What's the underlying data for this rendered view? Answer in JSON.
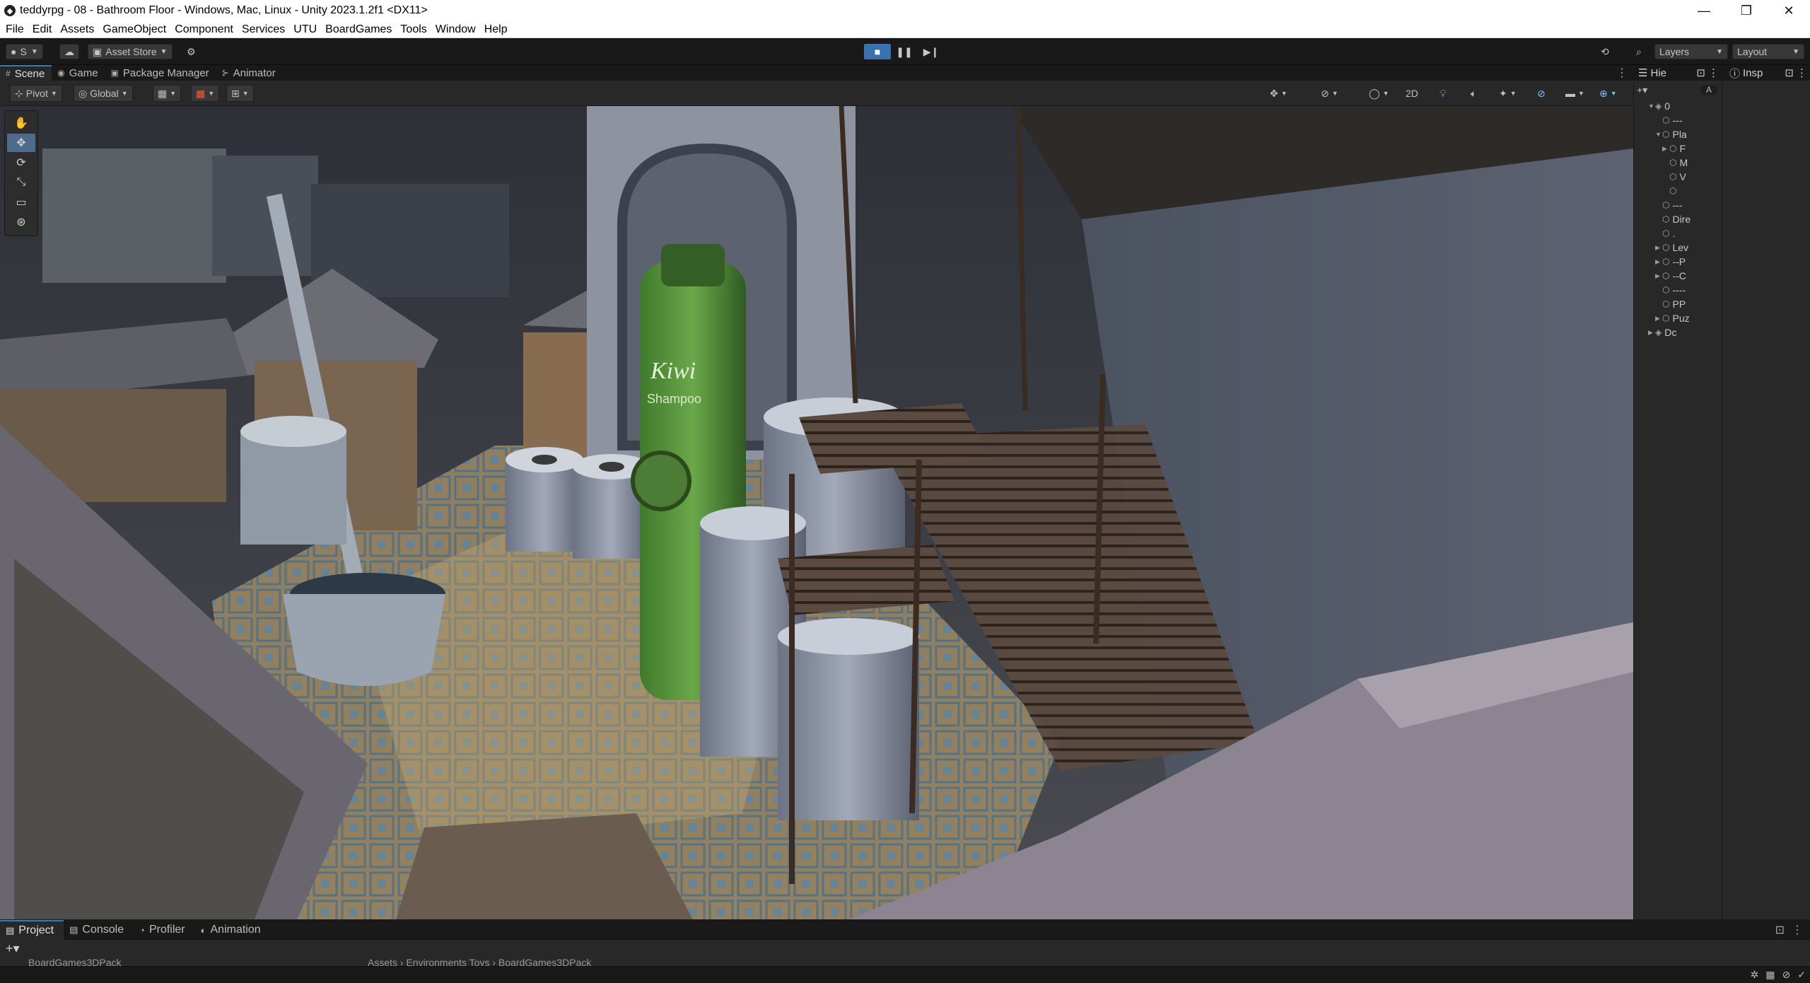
{
  "window": {
    "title": "teddyrpg - 08 - Bathroom Floor - Windows, Mac, Linux - Unity 2023.1.2f1 <DX11>",
    "controls": [
      "—",
      "❐",
      "✕"
    ]
  },
  "menu": [
    "File",
    "Edit",
    "Assets",
    "GameObject",
    "Component",
    "Services",
    "UTU",
    "BoardGames",
    "Tools",
    "Window",
    "Help"
  ],
  "toolbar": {
    "account_label": "S",
    "asset_store_label": "Asset Store",
    "layers_label": "Layers",
    "layout_label": "Layout",
    "play_active": "stop"
  },
  "tabs": [
    {
      "label": "Scene",
      "icon": "#"
    },
    {
      "label": "Game",
      "icon": "◉"
    },
    {
      "label": "Package Manager",
      "icon": "▣"
    },
    {
      "label": "Animator",
      "icon": "⊱"
    }
  ],
  "scene_tools": {
    "pivot_label": "Pivot",
    "global_label": "Global",
    "mode_2d_label": "2D"
  },
  "hierarchy": {
    "title": "Hie",
    "search_placeholder": "A",
    "rows": [
      {
        "indent": 0,
        "arrow": "▼",
        "label": "0",
        "icon": "◈"
      },
      {
        "indent": 1,
        "arrow": "",
        "label": "---",
        "icon": "⬡"
      },
      {
        "indent": 1,
        "arrow": "▼",
        "label": "Pla",
        "icon": "⬡"
      },
      {
        "indent": 2,
        "arrow": "▶",
        "label": "F",
        "icon": "⬡"
      },
      {
        "indent": 2,
        "arrow": "",
        "label": "M",
        "icon": "⬡"
      },
      {
        "indent": 2,
        "arrow": "",
        "label": "V",
        "icon": "⬡"
      },
      {
        "indent": 2,
        "arrow": "",
        "label": "",
        "icon": "⬡"
      },
      {
        "indent": 1,
        "arrow": "",
        "label": "---",
        "icon": "⬡"
      },
      {
        "indent": 1,
        "arrow": "",
        "label": "Dire",
        "icon": "⬡"
      },
      {
        "indent": 1,
        "arrow": "",
        "label": ".",
        "icon": "⬡"
      },
      {
        "indent": 1,
        "arrow": "▶",
        "label": "Lev",
        "icon": "⬡"
      },
      {
        "indent": 1,
        "arrow": "▶",
        "label": "--P",
        "icon": "⬡"
      },
      {
        "indent": 1,
        "arrow": "▶",
        "label": "--C",
        "icon": "⬡"
      },
      {
        "indent": 1,
        "arrow": "",
        "label": "----",
        "icon": "⬡"
      },
      {
        "indent": 1,
        "arrow": "",
        "label": "PP",
        "icon": "⬡"
      },
      {
        "indent": 1,
        "arrow": "▶",
        "label": "Puz",
        "icon": "⬡"
      },
      {
        "indent": 0,
        "arrow": "▶",
        "label": "Dc",
        "icon": "◈"
      }
    ]
  },
  "inspector": {
    "title": "Insp"
  },
  "bottom": {
    "tabs": [
      {
        "label": "Project",
        "icon": "▤"
      },
      {
        "label": "Console",
        "icon": "▤"
      },
      {
        "label": "Profiler",
        "icon": "◔"
      },
      {
        "label": "Animation",
        "icon": "◐"
      }
    ],
    "folder_label": "BoardGames3DPack",
    "path_label": "Assets › Environments Toys › BoardGames3DPack"
  },
  "scene_text": {
    "bottle_brand": "Kiwi",
    "bottle_sub": "Shampoo"
  },
  "colors": {
    "accent": "#3a72b0",
    "panel": "#282828",
    "dark": "#191919"
  }
}
